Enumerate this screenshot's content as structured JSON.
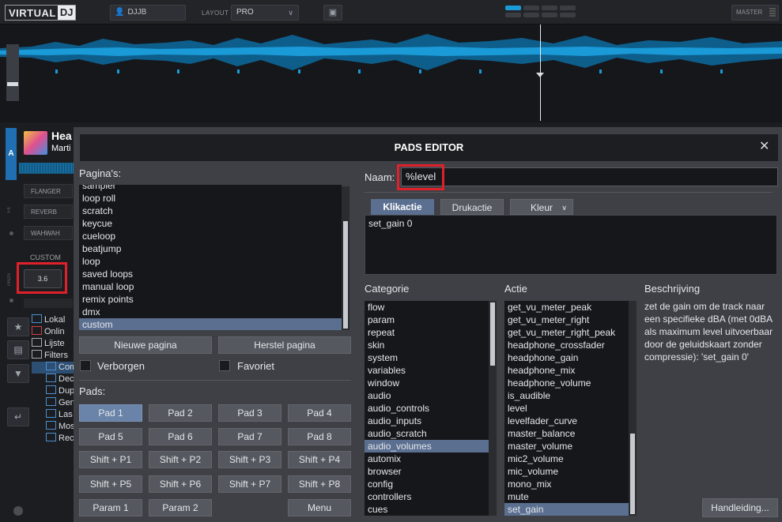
{
  "topbar": {
    "logo_part1": "VIRTUAL",
    "logo_part2": "DJ",
    "user": "DJJB",
    "user_icon": "user-icon",
    "layout_label": "LAYOUT",
    "layout_value": "PRO",
    "master_label": "MASTER"
  },
  "deck": {
    "letter": "A",
    "title": "Hea",
    "artist": "Marti",
    "fx": [
      "FLANGER",
      "REVERB",
      "WAHWAH"
    ],
    "fx_side_label": "FX",
    "pads_side_label": "PADS",
    "pads_mode": "CUSTOM",
    "pad_value": "3.6"
  },
  "browser_tree": [
    "Lokal",
    "Onlin",
    "Lijste",
    "Filters",
    "Com",
    "Dec",
    "Dup",
    "Gen",
    "Las",
    "Mos",
    "Rec"
  ],
  "dialog": {
    "title": "PADS EDITOR",
    "close": "✕",
    "pages_label": "Pagina's:",
    "pages": [
      "sampler",
      "loop roll",
      "scratch",
      "keycue",
      "cueloop",
      "beatjump",
      "loop",
      "saved loops",
      "manual loop",
      "remix points",
      "dmx",
      "custom"
    ],
    "selected_page": "custom",
    "new_page": "Nieuwe pagina",
    "restore_page": "Herstel pagina",
    "hidden_label": "Verborgen",
    "favorite_label": "Favoriet",
    "pads_label": "Pads:",
    "pads": [
      [
        "Pad 1",
        "Pad 2",
        "Pad 3",
        "Pad 4"
      ],
      [
        "Pad 5",
        "Pad 6",
        "Pad 7",
        "Pad 8"
      ],
      [
        "Shift + P1",
        "Shift + P2",
        "Shift + P3",
        "Shift + P4"
      ],
      [
        "Shift + P5",
        "Shift + P6",
        "Shift + P7",
        "Shift + P8"
      ]
    ],
    "param1": "Param 1",
    "param2": "Param 2",
    "menu": "Menu",
    "name_label": "Naam:",
    "name_value": "%level",
    "tabs": [
      "Klikactie",
      "Drukactie",
      "Kleur"
    ],
    "action_value": "set_gain 0",
    "category_label": "Categorie",
    "categories": [
      "flow",
      "param",
      "repeat",
      "skin",
      "system",
      "variables",
      "window",
      "audio",
      "audio_controls",
      "audio_inputs",
      "audio_scratch",
      "audio_volumes",
      "automix",
      "browser",
      "config",
      "controllers",
      "cues"
    ],
    "selected_category": "audio_volumes",
    "action_label": "Actie",
    "actions": [
      "get_vu_meter_peak",
      "get_vu_meter_right",
      "get_vu_meter_right_peak",
      "headphone_crossfader",
      "headphone_gain",
      "headphone_mix",
      "headphone_volume",
      "is_audible",
      "level",
      "levelfader_curve",
      "master_balance",
      "master_volume",
      "mic2_volume",
      "mic_volume",
      "mono_mix",
      "mute",
      "set_gain"
    ],
    "selected_action": "set_gain",
    "description_label": "Beschrijving",
    "description": "zet de gain om de track naar een specifieke dBA (met 0dBA als maximum level uitvoerbaar door de geluidskaart zonder compressie): 'set_gain 0'",
    "manual_button": "Handleiding..."
  },
  "colors": {
    "accent": "#5b6f91",
    "deck_blue": "#1f6fb2",
    "wave": "#1a9ad6",
    "highlight_red": "#e0202a"
  }
}
